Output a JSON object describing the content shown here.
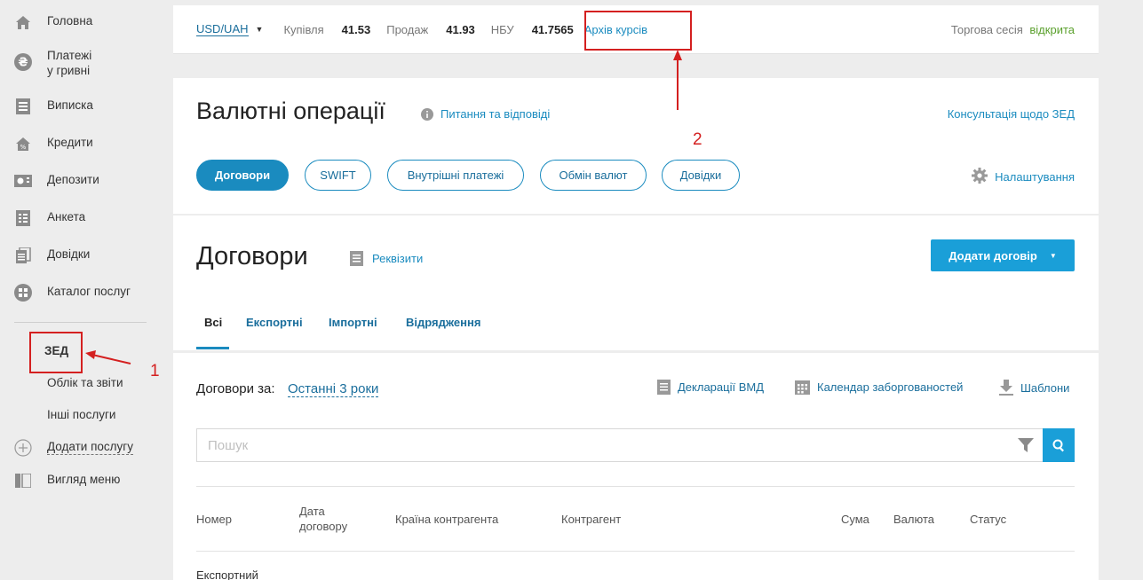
{
  "sidebar": {
    "items": [
      {
        "label": "Головна",
        "icon": "home-icon"
      },
      {
        "label": "Платежі",
        "label2": "у гривні",
        "icon": "hryvnia-icon"
      },
      {
        "label": "Виписка",
        "icon": "statement-icon"
      },
      {
        "label": "Кредити",
        "icon": "credit-icon"
      },
      {
        "label": "Депозити",
        "icon": "deposit-icon"
      },
      {
        "label": "Анкета",
        "icon": "questionnaire-icon"
      },
      {
        "label": "Довідки",
        "icon": "certificates-icon"
      },
      {
        "label": "Каталог послуг",
        "icon": "catalog-icon"
      }
    ],
    "sub": {
      "zed": "ЗЕД",
      "reports": "Облік та звіти",
      "other": "Інші послуги",
      "add_service": "Додати послугу",
      "menu_view": "Вигляд меню"
    }
  },
  "ratebar": {
    "currency": "USD/UAH",
    "buy_label": "Купівля",
    "buy_value": "41.53",
    "sell_label": "Продаж",
    "sell_value": "41.93",
    "nbu_label": "НБУ",
    "nbu_value": "41.7565",
    "archive": "Архів курсів",
    "session_label": "Торгова сесія",
    "session_status": "відкрита"
  },
  "ops": {
    "title": "Валютні операції",
    "qa": "Питання та відповіді",
    "consult": "Консультація щодо ЗЕД",
    "tabs": [
      "Договори",
      "SWIFT",
      "Внутрішні платежі",
      "Обмін валют",
      "Довідки"
    ],
    "settings": "Налаштування"
  },
  "contracts": {
    "title": "Договори",
    "requisites": "Реквізити",
    "add_button": "Додати договір",
    "tabs": [
      "Всі",
      "Експортні",
      "Імпортні",
      "Відрядження"
    ]
  },
  "list": {
    "period_label": "Договори за:",
    "period_value": "Останні 3 роки",
    "tools": {
      "declarations": "Декларації ВМД",
      "calendar": "Календар заборгованостей",
      "templates": "Шаблони"
    },
    "search_placeholder": "Пошук",
    "columns": {
      "number": "Номер",
      "date1": "Дата",
      "date2": "договору",
      "country": "Країна контрагента",
      "counterparty": "Контрагент",
      "sum": "Сума",
      "currency": "Валюта",
      "status": "Статус"
    },
    "rows": [
      {
        "number": "Експортний"
      }
    ]
  },
  "annotations": {
    "n1": "1",
    "n2": "2"
  },
  "colors": {
    "accent": "#1a8bbf",
    "annotation": "#d42020",
    "success": "#5aa02c"
  }
}
